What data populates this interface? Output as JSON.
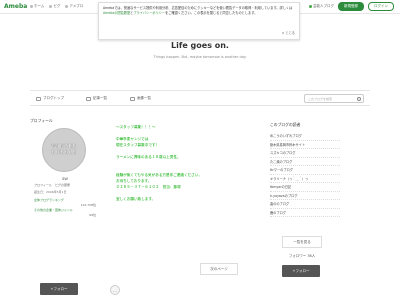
{
  "header": {
    "logo": "Ameba",
    "nav": [
      "ホーム",
      "ピグ",
      "アメブロ"
    ],
    "pr_label": "芸能人ブログ",
    "register": "新規登録",
    "login": "ログイン"
  },
  "notice": {
    "line1": "Amebaでは、快適なサービス提供や利用分析、広告配信のためにクッキーなどを使い閲覧データの取得・利用しています。詳しくは",
    "link1": "Amebaの閲覧履歴",
    "mid": "と",
    "link2": "プライバシーポリシー",
    "line2": "をご確認ください。この表示を閉じると同意したものとします。",
    "close": "とじる"
  },
  "blog": {
    "title": "Life goes on.",
    "subtitle": "Things happen. But, maybe tomorrow is another day."
  },
  "gnav": {
    "top": "ブログトップ",
    "list": "記事一覧",
    "images": "画像一覧",
    "search_placeholder": "このブログを検索"
  },
  "profile": {
    "title": "プロフィール",
    "avatar_text": "WINTER BUBBLE",
    "name": "SW",
    "link_profile": "プロフィール",
    "link_pig": "ピグの部屋",
    "date": "誕生日：2006年5月1日",
    "ranks": [
      {
        "label": "全体ブログランキング",
        "value": "112,728位"
      },
      {
        "label": "その他の企業・団体ジャンル",
        "value": "99位"
      }
    ],
    "follow": "+フォロー",
    "more": "…"
  },
  "article": {
    "lines": [
      "～スタッフ募集！！！～",
      "",
      "中華亭麦ヤンジでは",
      "現在スタッフ募集中です！",
      "",
      "ラーメンに興味のある１８歳以上男性。",
      "",
      "",
      "経験が無くてもやる気がある方是非ご連絡ください。",
      "お待ちしております。",
      "０２８５－３７－６１０２　担当：藤塚",
      "",
      "宜しくお願い致します。"
    ],
    "next": "次のページ"
  },
  "sidebar": {
    "title": "このブログの読者",
    "items": [
      "めこうのいずれブログ",
      "栃木県真岡市鈴木サイト",
      "スズキコのブログ",
      "たこ焼のブログ",
      "ttrマーのブログ",
      "キラリーナ（っ＾＿＾）っ",
      "tbmyarの日記",
      "h-yayavaのブログ",
      "曲ののブログ",
      "鹿のブログ"
    ],
    "more": "一覧を見る",
    "followers": "フォロワー 36人",
    "follow": "+フォロー"
  }
}
